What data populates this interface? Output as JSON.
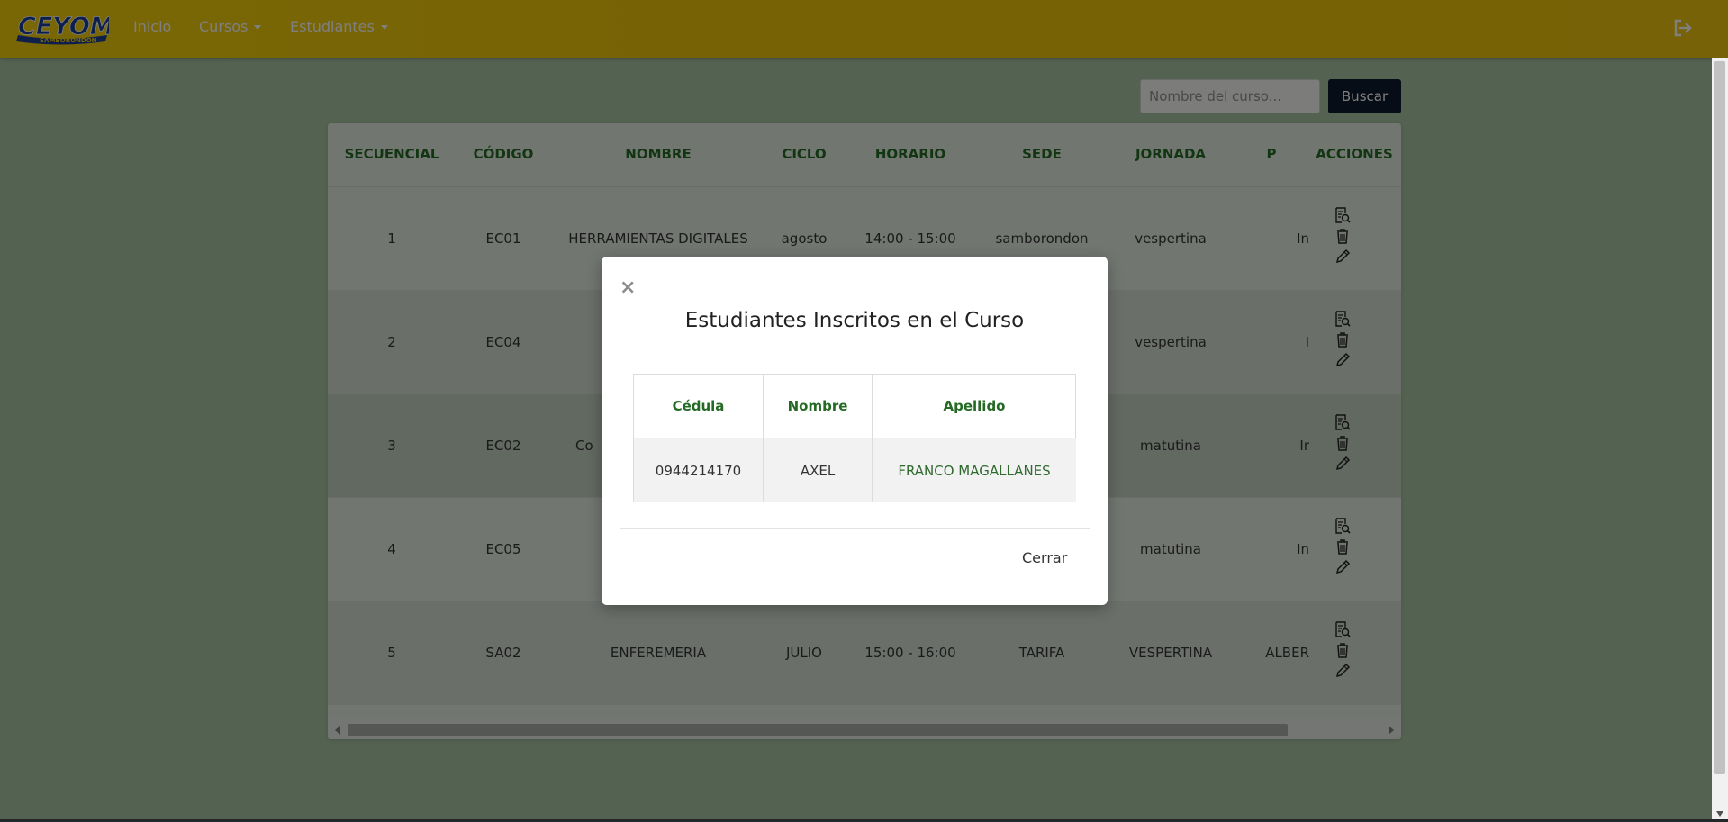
{
  "nav": {
    "logo_text": "CEYOM",
    "logo_subtext": "SAMBORONDON",
    "inicio": "Inicio",
    "cursos": "Cursos",
    "estudiantes": "Estudiantes"
  },
  "search": {
    "placeholder": "Nombre del curso...",
    "button": "Buscar"
  },
  "table": {
    "headers": [
      "SECUENCIAL",
      "CÓDIGO",
      "NOMBRE",
      "CICLO",
      "HORARIO",
      "SEDE",
      "JORNADA",
      "P",
      "ACCIONES"
    ],
    "rows": [
      {
        "secuencial": "1",
        "codigo": "EC01",
        "nombre": "HERRAMIENTAS DIGITALES",
        "ciclo": "agosto",
        "horario": "14:00 - 15:00",
        "sede": "samborondon",
        "jornada": "vespertina",
        "p": "In"
      },
      {
        "secuencial": "2",
        "codigo": "EC04",
        "nombre": "",
        "ciclo": "",
        "horario": "",
        "sede": "",
        "jornada": "vespertina",
        "p": "I"
      },
      {
        "secuencial": "3",
        "codigo": "EC02",
        "nombre": "Co",
        "ciclo": "",
        "horario": "",
        "sede": "",
        "jornada": "matutina",
        "p": "Ir"
      },
      {
        "secuencial": "4",
        "codigo": "EC05",
        "nombre": "",
        "ciclo": "",
        "horario": "",
        "sede": "",
        "jornada": "matutina",
        "p": "In"
      },
      {
        "secuencial": "5",
        "codigo": "SA02",
        "nombre": "ENFEREMERIA",
        "ciclo": "JULIO",
        "horario": "15:00 - 16:00",
        "sede": "TARIFA",
        "jornada": "VESPERTINA",
        "p": "ALBER"
      }
    ]
  },
  "modal": {
    "close_glyph": "×",
    "title": "Estudiantes Inscritos en el Curso",
    "headers": [
      "Cédula",
      "Nombre",
      "Apellido"
    ],
    "row": {
      "cedula": "0944214170",
      "nombre": "AXEL",
      "apellido": "FRANCO MAGALLANES"
    },
    "cerrar": "Cerrar"
  },
  "colors": {
    "navbar": "#f0c70c",
    "header_text": "#256a24",
    "search_button": "#0d1a2c"
  }
}
